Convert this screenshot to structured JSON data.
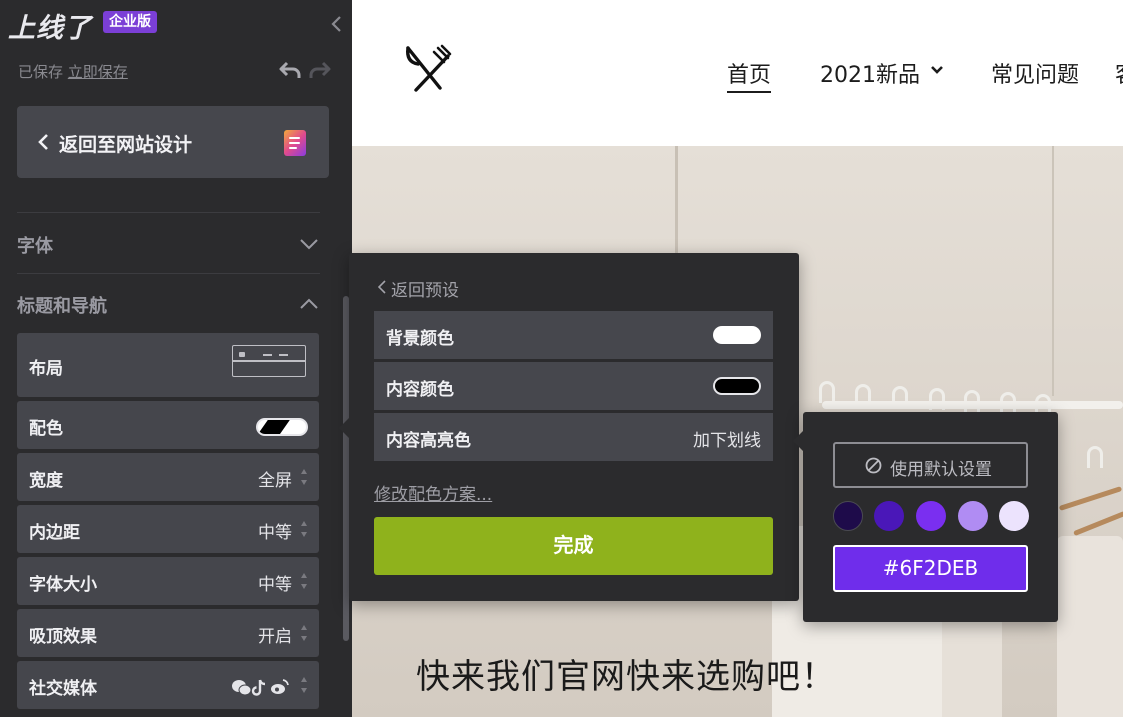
{
  "sidebar": {
    "logo": "上线了",
    "badge": "企业版",
    "saved_text": "已保存",
    "save_now": "立即保存",
    "back_to_design": "返回至网站设计",
    "sections": [
      {
        "title": "字体",
        "expanded": false
      },
      {
        "title": "标题和导航",
        "expanded": true
      }
    ],
    "settings": [
      {
        "label": "布局",
        "value": ""
      },
      {
        "label": "配色",
        "value": ""
      },
      {
        "label": "宽度",
        "value": "全屏"
      },
      {
        "label": "内边距",
        "value": "中等"
      },
      {
        "label": "字体大小",
        "value": "中等"
      },
      {
        "label": "吸顶效果",
        "value": "开启"
      },
      {
        "label": "社交媒体",
        "value": ""
      }
    ]
  },
  "site": {
    "nav": [
      "首页",
      "2021新品",
      "常见问题",
      "客"
    ],
    "hero_text": "快来我们官网快来选购吧！"
  },
  "color_panel": {
    "back": "返回预设",
    "rows": [
      {
        "label": "背景颜色",
        "swatch": "#ffffff"
      },
      {
        "label": "内容颜色",
        "swatch": "#000000"
      },
      {
        "label": "内容高亮色",
        "value": "加下划线"
      }
    ],
    "modify_link": "修改配色方案...",
    "done": "完成"
  },
  "picker": {
    "default_label": "使用默认设置",
    "swatches": [
      "#1e0b4a",
      "#4a17b8",
      "#7a2ff0",
      "#b08cf3",
      "#ece3fd"
    ],
    "hex": "#6F2DEB",
    "hex_color": "#6f2deb"
  }
}
